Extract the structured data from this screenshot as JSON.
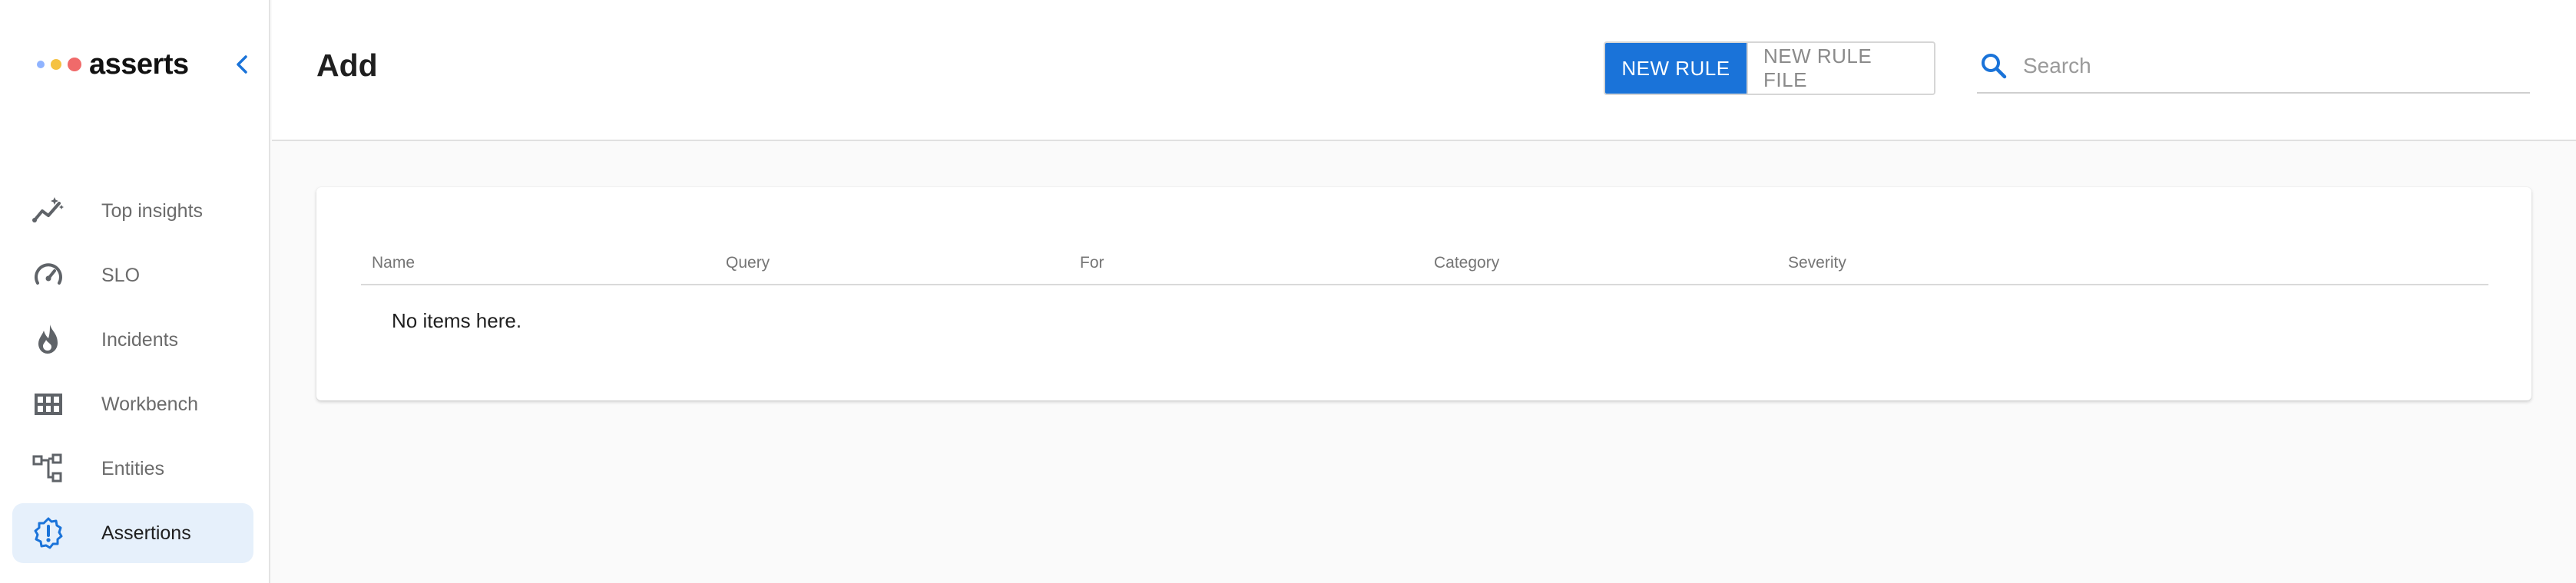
{
  "brand": {
    "name": "asserts"
  },
  "colors": {
    "accent": "#1a73d9",
    "active_bg": "#e6f0fb"
  },
  "sidebar": {
    "collapse_icon": "chevron-left-icon",
    "items": [
      {
        "label": "Top insights",
        "icon": "insights-icon",
        "active": false
      },
      {
        "label": "SLO",
        "icon": "speedometer-icon",
        "active": false
      },
      {
        "label": "Incidents",
        "icon": "flame-icon",
        "active": false
      },
      {
        "label": "Workbench",
        "icon": "grid-icon",
        "active": false
      },
      {
        "label": "Entities",
        "icon": "hierarchy-icon",
        "active": false
      },
      {
        "label": "Assertions",
        "icon": "alert-badge-icon",
        "active": true
      }
    ]
  },
  "header": {
    "title": "Add",
    "new_rule_label": "NEW RULE",
    "new_rule_file_label": "NEW RULE FILE",
    "search": {
      "placeholder": "Search",
      "value": ""
    }
  },
  "table": {
    "columns": [
      "Name",
      "Query",
      "For",
      "Category",
      "Severity"
    ],
    "rows": [],
    "empty_message": "No items here."
  }
}
